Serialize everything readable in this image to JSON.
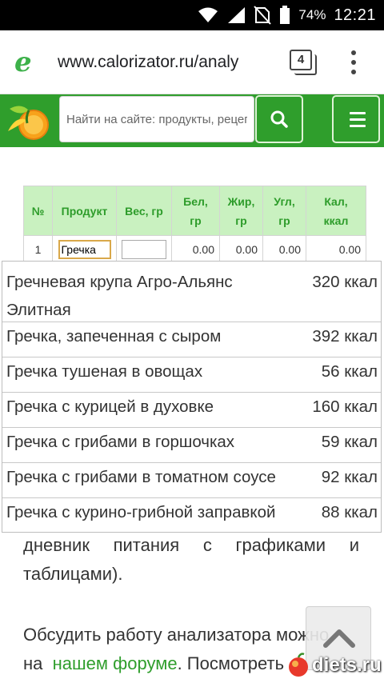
{
  "status_bar": {
    "battery_pct": "74%",
    "time": "12:21"
  },
  "browser": {
    "url": "www.calorizator.ru/analy",
    "tab_count": "4"
  },
  "site_header": {
    "search_placeholder": "Найти на сайте: продукты, рецепты"
  },
  "table": {
    "headers": [
      "№",
      "Продукт",
      "Вес, гр",
      "Бел, гр",
      "Жир, гр",
      "Угл, гр",
      "Кал, ккал"
    ],
    "row": {
      "num": "1",
      "product": "Гречка",
      "weight": "",
      "protein": "0.00",
      "fat": "0.00",
      "carbs": "0.00",
      "kcal": "0.00"
    }
  },
  "autocomplete": [
    {
      "name": "Гречневая крупа Агро-Альянс Элитная",
      "kcal": "320 ккал"
    },
    {
      "name": "Гречка, запеченная с сыром",
      "kcal": "392 ккал"
    },
    {
      "name": "Гречка тушеная в овощах",
      "kcal": "56 ккал"
    },
    {
      "name": "Гречка с курицей в духовке",
      "kcal": "160 ккал"
    },
    {
      "name": "Гречка с грибами в горшочках",
      "kcal": "59 ккал"
    },
    {
      "name": "Гречка с грибами в томатном соусе",
      "kcal": "92 ккал"
    },
    {
      "name": "Гречка с курино-грибной заправкой",
      "kcal": "88 ккал"
    }
  ],
  "paragraph1": {
    "line1": [
      "дневник",
      "питания",
      "с",
      "графиками",
      "и"
    ],
    "line2": "таблицами)."
  },
  "paragraph2": {
    "line1": "Обсудить работу анализатора можно",
    "line2_prefix": "на",
    "link": "нашем форуме",
    "line2_suffix": ". Посмотреть"
  },
  "watermark": {
    "text": "diets.ru"
  },
  "colors": {
    "brand_green": "#2f9e2c",
    "header_cell_bg": "#c9f1c0",
    "link_green": "#2f9e2c"
  },
  "icons": {
    "browser_logo": "chrome-lite-logo-icon",
    "search": "search-icon",
    "menu": "hamburger-menu-icon",
    "scroll_top": "chevron-up-icon"
  }
}
